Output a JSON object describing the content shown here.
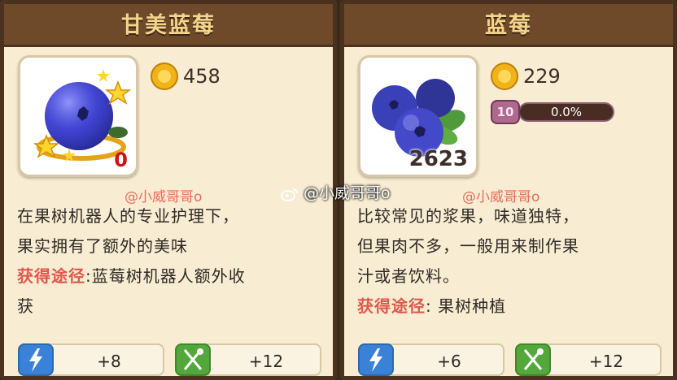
{
  "left_card": {
    "title": "甘美蓝莓",
    "icon": "golden-blueberry-icon",
    "quantity": "0",
    "price": "458",
    "description_lines": [
      "在果树机器人的专业护理下，",
      "果实拥有了额外的美味"
    ],
    "source_label": "获得途径",
    "source_lines": [
      ":蓝莓树机器人额外收",
      "获"
    ],
    "stats": {
      "energy": "+8",
      "food": "+12"
    }
  },
  "right_card": {
    "title": "蓝莓",
    "icon": "blueberry-icon",
    "quantity": "2623",
    "price": "229",
    "level": "10",
    "level_progress": "0.0%",
    "level_progress_value": 0.0,
    "description_lines": [
      "比较常见的浆果，味道独特，",
      "但果肉不多，一般用来制作果",
      "汁或者饮料。"
    ],
    "source_label": "获得途径",
    "source_value": ": 果树种植",
    "stats": {
      "energy": "+6",
      "food": "+12"
    }
  },
  "watermarks": {
    "left": "@小威哥哥o",
    "right": "@小威哥哥o",
    "weibo": "@小威哥哥o"
  },
  "colors": {
    "panel": "#f8ecd2",
    "title_bar": "#6e4a2b",
    "title_text": "#f3d489",
    "source_red": "#e0584e",
    "energy_blue": "#3a82d8",
    "food_green": "#52a83a"
  }
}
